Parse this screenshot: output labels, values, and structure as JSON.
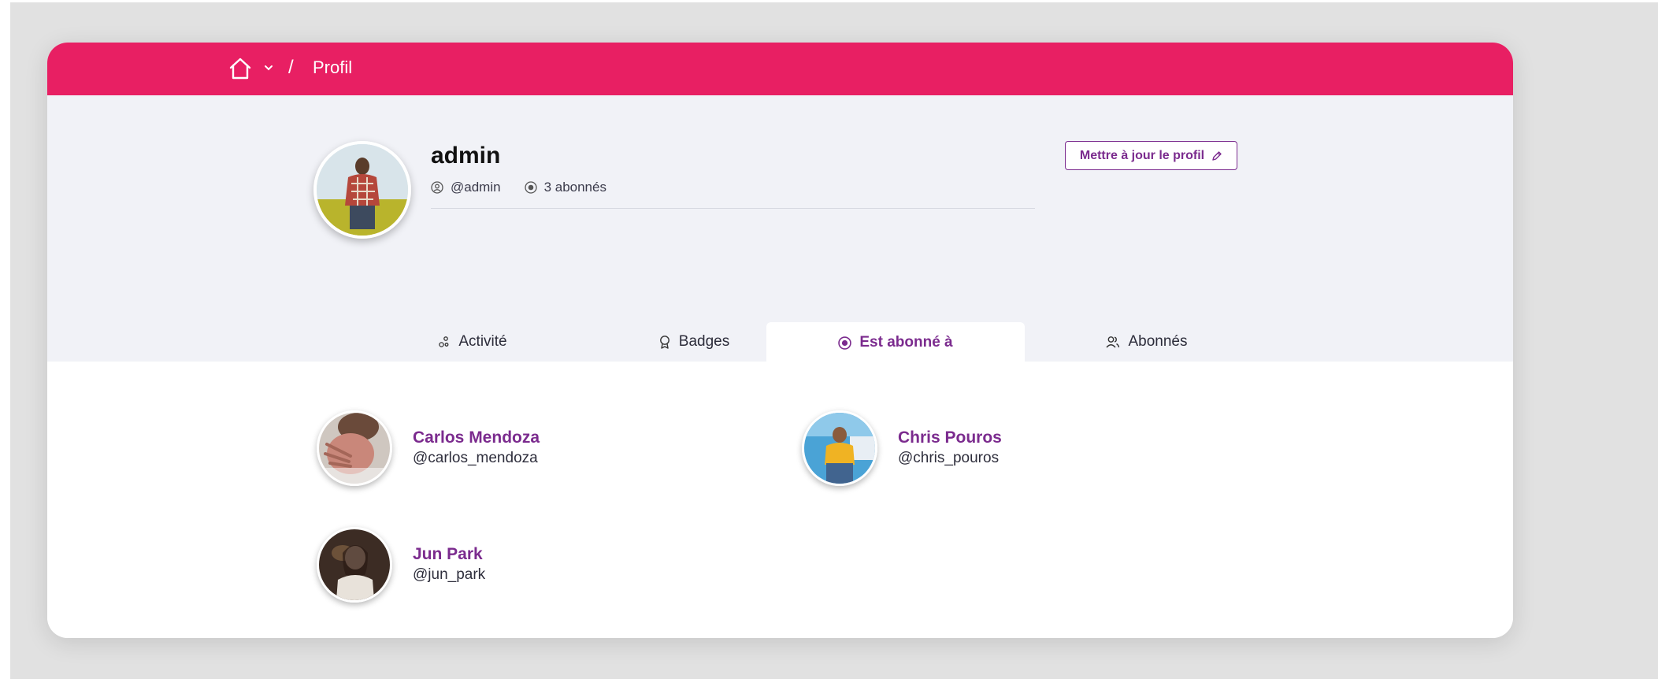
{
  "breadcrumb": {
    "home_icon": "home-icon",
    "dropdown_icon": "chevron-down-icon",
    "separator": "/",
    "current": "Profil"
  },
  "profile": {
    "name": "admin",
    "handle": "@admin",
    "followers": "3 abonnés",
    "update_button": "Mettre à jour le profil"
  },
  "tabs": [
    {
      "label": "Activité",
      "icon": "activity-icon",
      "active": false
    },
    {
      "label": "Badges",
      "icon": "badge-icon",
      "active": false
    },
    {
      "label": "Est abonné à",
      "icon": "following-icon",
      "active": true
    },
    {
      "label": "Abonnés",
      "icon": "followers-icon",
      "active": false
    }
  ],
  "following": [
    {
      "name": "Carlos Mendoza",
      "handle": "@carlos_mendoza"
    },
    {
      "name": "Chris Pouros",
      "handle": "@chris_pouros"
    },
    {
      "name": "Jun Park",
      "handle": "@jun_park"
    }
  ],
  "colors": {
    "topbar": "#e81f63",
    "accent": "#7b2b8e",
    "hero_bg": "#f1f2f7"
  }
}
